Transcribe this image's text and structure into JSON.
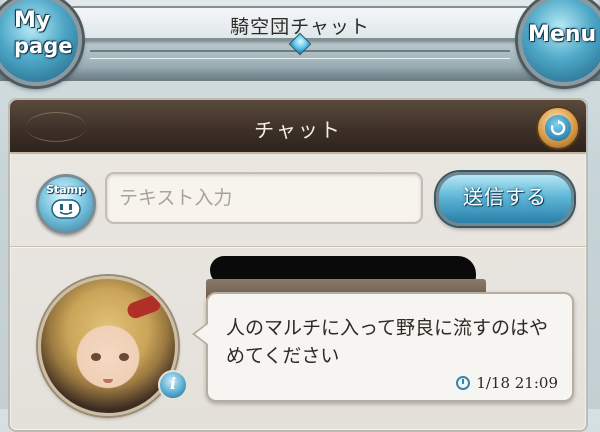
{
  "header": {
    "title": "騎空団チャット",
    "mypage_line1": "My",
    "mypage_line2": "page",
    "menu_label": "Menu"
  },
  "chat_panel": {
    "title": "チャット",
    "stamp_label": "Stamp",
    "input_placeholder": "テキスト入力",
    "send_label": "送信する"
  },
  "messages": [
    {
      "text": "人のマルチに入って野良に流すのはやめてください",
      "time": "1/18 21:09"
    }
  ],
  "icons": {
    "refresh": "refresh-icon",
    "stamp_face": "smiley-icon",
    "info": "info-icon",
    "clock": "clock-icon"
  },
  "colors": {
    "accent_blue": "#4ea8c8",
    "panel_header": "#3c2f27",
    "bubble": "#f7f5f1"
  }
}
